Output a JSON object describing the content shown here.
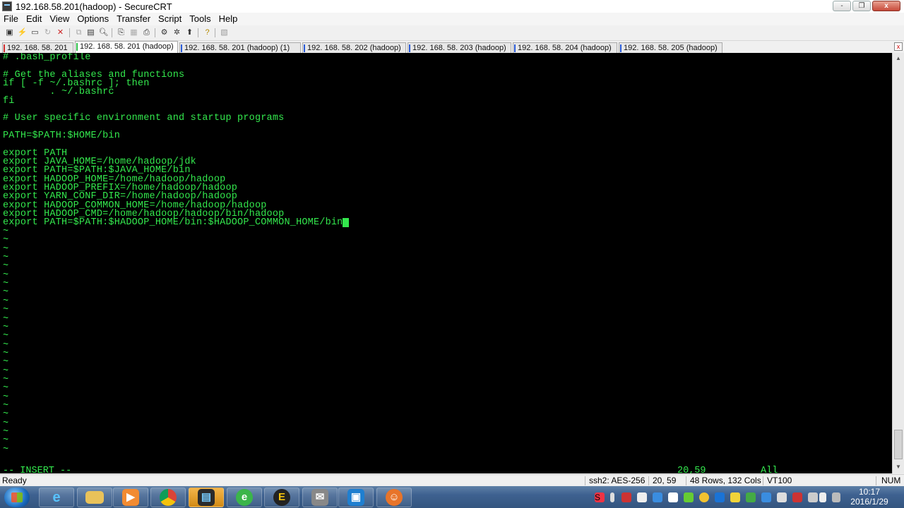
{
  "window": {
    "title": "192.168.58.201(hadoop) - SecureCRT",
    "buttons": [
      "-",
      "❐",
      "x"
    ]
  },
  "menu": [
    "File",
    "Edit",
    "View",
    "Options",
    "Transfer",
    "Script",
    "Tools",
    "Help"
  ],
  "toolbar_icons": [
    "connect-icon",
    "quick-connect-icon",
    "connect-in-tab-icon",
    "reconnect-icon",
    "disconnect-icon",
    "copy-icon",
    "paste-icon",
    "copy-paste-icon",
    "find-icon",
    "print-icon",
    "print-selection-icon",
    "print-setup-icon",
    "session-options-icon",
    "global-options-icon",
    "keymap-icon",
    "help-icon",
    "sftp-icon"
  ],
  "tabs": [
    "192. 168. 58. 201",
    "192. 168. 58. 201 (hadoop)",
    "192. 168. 58. 201 (hadoop)   (1)",
    "192. 168. 58. 202 (hadoop)",
    "192. 168. 58. 203 (hadoop)",
    "192. 168. 58. 204 (hadoop)",
    "192. 168. 58. 205 (hadoop)"
  ],
  "tab_close": "x",
  "terminal": {
    "lines": [
      "# .bash_profile",
      "",
      "# Get the aliases and functions",
      "if [ -f ~/.bashrc ]; then",
      "        . ~/.bashrc",
      "fi",
      "",
      "# User specific environment and startup programs",
      "",
      "PATH=$PATH:$HOME/bin",
      "",
      "export PATH",
      "export JAVA_HOME=/home/hadoop/jdk",
      "export PATH=$PATH:$JAVA_HOME/bin",
      "export HADOOP_HOME=/home/hadoop/hadoop",
      "export HADOOP_PREFIX=/home/hadoop/hadoop",
      "export YARN_CONF_DIR=/home/hadoop/hadoop",
      "export HADOOP_COMMON_HOME=/home/hadoop/hadoop",
      "export HADOOP_CMD=/home/hadoop/hadoop/bin/hadoop",
      "export PATH=$PATH:$HADOOP_HOME/bin:$HADOOP_COMMON_HOME/bin"
    ],
    "tilde": "~",
    "mode": "-- INSERT --",
    "position": "20,59",
    "scroll": "All"
  },
  "statusbar": {
    "ready": "Ready",
    "cipher": "ssh2: AES-256",
    "cursor": "20,  59",
    "size": "48 Rows, 132 Cols",
    "emulation": "VT100",
    "numlock": "NUM"
  },
  "taskbar": {
    "apps": [
      "internet-explorer-icon",
      "file-explorer-icon",
      "media-player-icon",
      "chrome-icon",
      "securecrt-icon",
      "browser-icon",
      "app-icon",
      "email-client-icon",
      "virtualbox-icon",
      "game-icon"
    ],
    "time": "10:17",
    "date": "2016/1/29"
  },
  "colors": {
    "terminal_fg": "#33e84d",
    "terminal_bg": "#000000"
  }
}
